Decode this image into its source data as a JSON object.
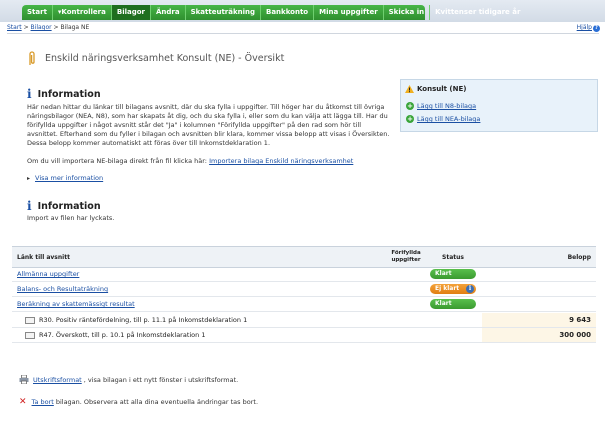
{
  "nav": {
    "items": [
      {
        "label": "Start",
        "active": false
      },
      {
        "label": "▾Kontrollera",
        "active": false
      },
      {
        "label": "Bilagor",
        "active": true
      },
      {
        "label": "Ändra",
        "active": false
      },
      {
        "label": "Skatteuträkning",
        "active": false
      },
      {
        "label": "Bankkonto",
        "active": false
      },
      {
        "label": "Mina uppgifter",
        "active": false
      },
      {
        "label": "Skicka in",
        "active": false
      },
      {
        "label": "Kvittenser tidigare år",
        "active": false
      }
    ]
  },
  "breadcrumb": {
    "start": "Start",
    "sep": ">",
    "bilagor": "Bilagor",
    "current": "Bilaga NE"
  },
  "help": {
    "label": "Hjälp"
  },
  "page": {
    "title": "Enskild näringsverksamhet Konsult (NE) - Översikt"
  },
  "sidebox": {
    "title": "Konsult (NE)",
    "links": [
      "Lägg till N8-bilaga",
      "Lägg till NEA-bilaga"
    ]
  },
  "info1": {
    "heading": "Information",
    "text": "Här nedan hittar du länkar till bilagans avsnitt, där du ska fylla i uppgifter. Till höger har du åtkomst till övriga näringsbilagor (NEA, N8), som har skapats åt dig, och du ska fylla i, eller som du kan välja att lägga till. Har du förifyllda uppgifter i något avsnitt står det \"Ja\" i kolumnen \"Förifyllda uppgifter\" på den rad som hör till avsnittet. Efterhand som du fyller i bilagan och avsnitten blir klara, kommer vissa belopp att visas i Översikten. Dessa belopp kommer automatiskt att föras över till Inkomstdeklaration 1.",
    "import_prefix": "Om du vill importera NE-bilaga direkt från fil klicka här:",
    "import_link": "Importera bilaga Enskild näringsverksamhet",
    "more_link": "Visa mer information"
  },
  "info2": {
    "heading": "Information",
    "text": "Import av filen har lyckats."
  },
  "table": {
    "headers": {
      "section": "Länk till avsnitt",
      "prefilled": "Förifyllda uppgifter",
      "status": "Status",
      "amount": "Belopp"
    },
    "rows": [
      {
        "label": "Allmänna uppgifter",
        "status": "Klart",
        "status_color": "#3a9a30",
        "info": false
      },
      {
        "label": "Balans- och Resultaträkning",
        "status": "Ej klart",
        "status_color": "#e07e12",
        "info": true
      },
      {
        "label": "Beräkning av skattemässigt resultat",
        "status": "Klart",
        "status_color": "#3a9a30",
        "info": false
      }
    ],
    "calc_rows": [
      {
        "label": "R30. Positiv räntefördelning, till p. 11.1 på Inkomstdeklaration 1",
        "amount": "9 643"
      },
      {
        "label": "R47. Överskott, till p. 10.1 på Inkomstdeklaration 1",
        "amount": "300 000"
      }
    ]
  },
  "footer": {
    "print_link": "Utskriftsformat",
    "print_text": ", visa bilagan i ett nytt fönster i utskriftsformat.",
    "delete_link": "Ta bort",
    "delete_text": "bilagan. Observera att alla dina eventuella ändringar tas bort."
  }
}
